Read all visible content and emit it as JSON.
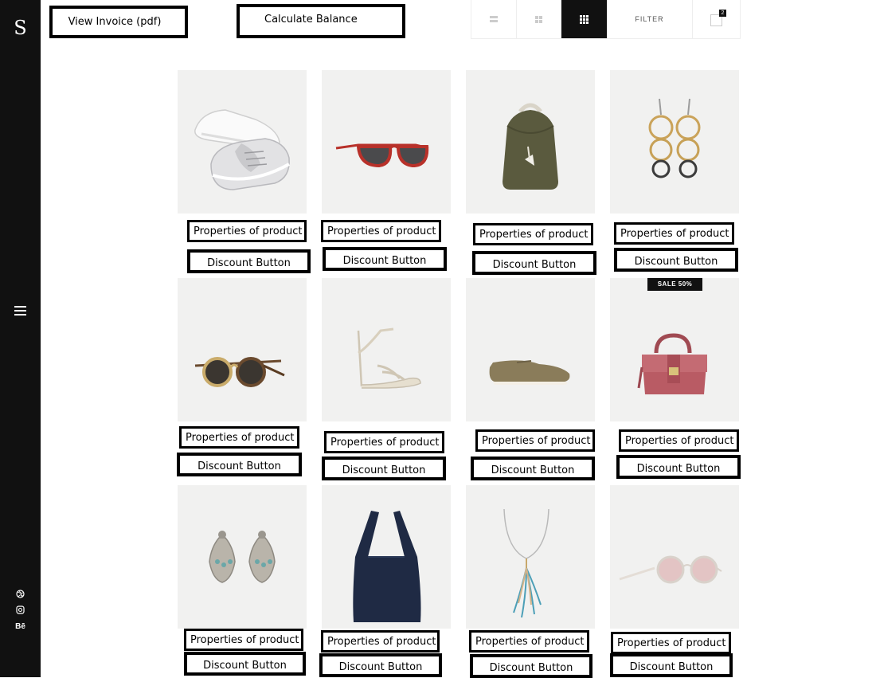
{
  "sidebar": {
    "logo": "S",
    "social": [
      "dribbble-icon",
      "instagram-icon",
      "behance-icon"
    ],
    "behance_label": "Bē"
  },
  "header": {
    "invoice_label": "View Invoice (pdf)",
    "balance_label": "Calculate Balance"
  },
  "toolbar": {
    "filter_label": "FILTER",
    "cart_count": "2",
    "views": [
      "list-view-icon",
      "grid-2-view-icon",
      "grid-3-view-icon"
    ],
    "active_view": "grid-3-view-icon"
  },
  "products": [
    {
      "item": "sneakers",
      "properties_label": "Properties of product",
      "discount_label": "Discount Button"
    },
    {
      "item": "red-sunglasses",
      "properties_label": "Properties of product",
      "discount_label": "Discount Button"
    },
    {
      "item": "green-backpack",
      "properties_label": "Properties of product",
      "discount_label": "Discount Button"
    },
    {
      "item": "hoop-earrings",
      "properties_label": "Properties of product",
      "discount_label": "Discount Button"
    },
    {
      "item": "tortoise-sunglasses",
      "properties_label": "Properties of product",
      "discount_label": "Discount Button"
    },
    {
      "item": "strappy-heels",
      "properties_label": "Properties of product",
      "discount_label": "Discount Button"
    },
    {
      "item": "suede-shoe",
      "properties_label": "Properties of product",
      "discount_label": "Discount Button"
    },
    {
      "item": "pink-handbag",
      "properties_label": "Properties of product",
      "discount_label": "Discount Button",
      "badge": "SALE 50%"
    },
    {
      "item": "chandelier-earrings",
      "properties_label": "Properties of product",
      "discount_label": "Discount Button"
    },
    {
      "item": "navy-tote",
      "properties_label": "Properties of product",
      "discount_label": "Discount Button"
    },
    {
      "item": "feather-necklace",
      "properties_label": "Properties of product",
      "discount_label": "Discount Button"
    },
    {
      "item": "round-sunglasses",
      "properties_label": "Properties of product",
      "discount_label": "Discount Button"
    }
  ],
  "colors": {
    "sidebar": "#111111",
    "product_bg": "#f1f1f0",
    "button_border": "#000000"
  }
}
